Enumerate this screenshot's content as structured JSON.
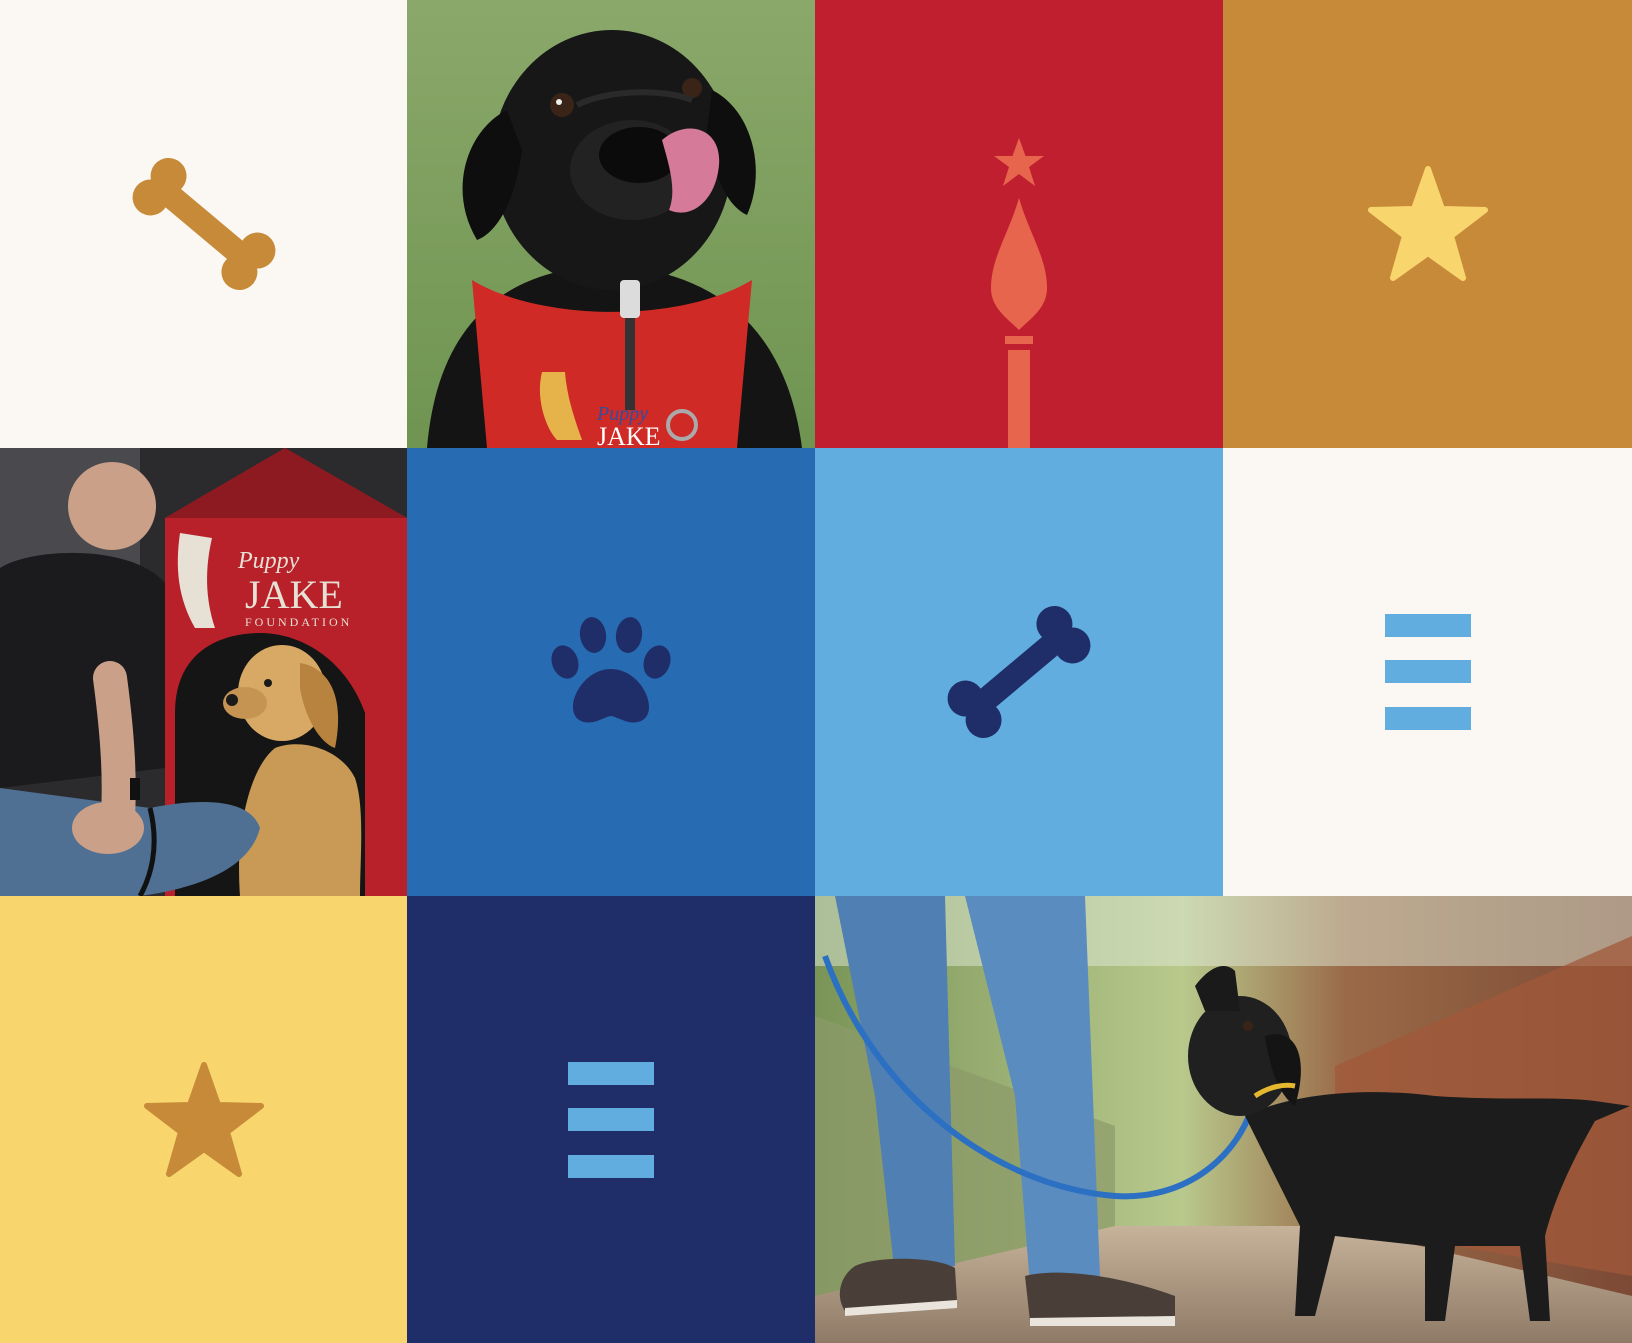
{
  "colors": {
    "cream": "#fbf8f3",
    "red": "#c01f30",
    "coral": "#e8654d",
    "gold": "#c78a38",
    "light_yellow": "#f9d56e",
    "blue": "#276bb3",
    "light_blue": "#61ade0",
    "navy": "#1f2e68"
  },
  "tiles": [
    {
      "name": "tile-bone-cream",
      "icon": "bone-icon"
    },
    {
      "name": "photo-black-lab-bandana",
      "icon": "photo"
    },
    {
      "name": "tile-torch-red",
      "icon": "torch-icon"
    },
    {
      "name": "tile-star-gold",
      "icon": "star-icon"
    },
    {
      "name": "photo-man-golden-retriever",
      "icon": "photo"
    },
    {
      "name": "tile-paw-blue",
      "icon": "paw-icon"
    },
    {
      "name": "tile-bone-light-blue",
      "icon": "bone-icon"
    },
    {
      "name": "tile-stripes-cream",
      "icon": "three-stripes-icon"
    },
    {
      "name": "tile-star-yellow",
      "icon": "star-icon"
    },
    {
      "name": "tile-stripes-navy",
      "icon": "three-stripes-icon"
    },
    {
      "name": "photo-puppy-leash",
      "icon": "photo"
    }
  ],
  "bandana_logo": {
    "script": "Puppy",
    "name": "JAKE"
  },
  "doghouse_sign": {
    "script": "Puppy",
    "name": "JAKE",
    "subtitle": "FOUNDATION"
  }
}
